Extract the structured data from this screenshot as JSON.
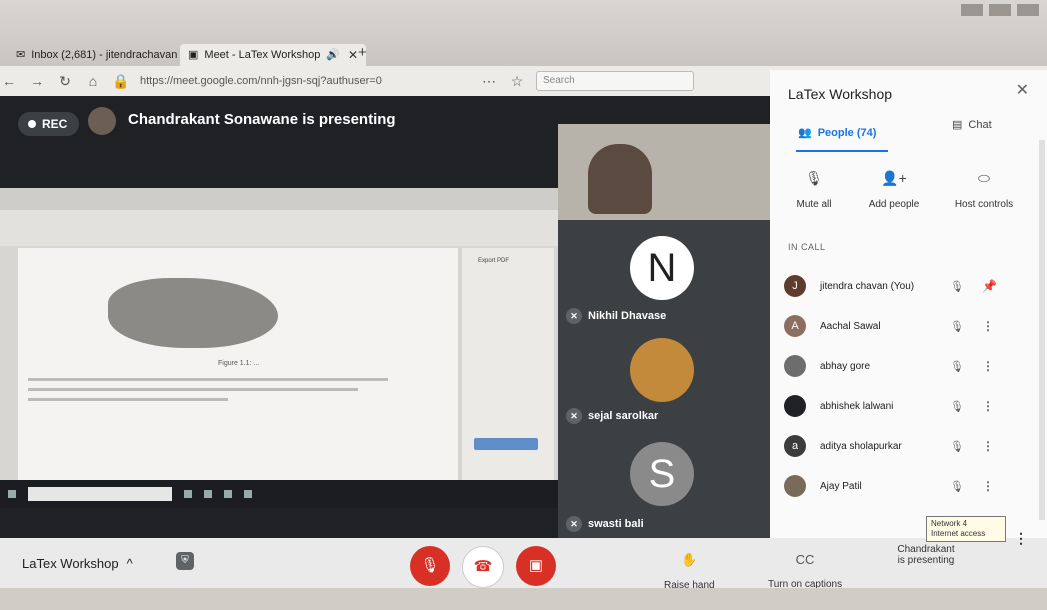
{
  "browser": {
    "tabs": [
      {
        "label": "Inbox (2,681) - jitendrachavan",
        "icon": "mail-icon"
      },
      {
        "label": "Meet - LaTex Workshop",
        "icon": "meet-icon"
      }
    ],
    "url": "https://meet.google.com/nnh-jgsn-sqj?authuser=0",
    "search_placeholder": "Search"
  },
  "meet": {
    "rec_label": "REC",
    "presenting_title": "Chandrakant Sonawane is presenting",
    "tiles": [
      {
        "name": "Nikhil Dhavase",
        "initial": "N"
      },
      {
        "name": "sejal sarolkar",
        "initial": ""
      },
      {
        "name": "swasti bali",
        "initial": "S"
      }
    ],
    "presentation": {
      "side_title": "Export PDF",
      "caption": "Figure 1.1: ..."
    }
  },
  "panel": {
    "title": "LaTex Workshop",
    "people_tab": "People (74)",
    "chat_tab": "Chat",
    "mute_all": "Mute all",
    "add_people": "Add people",
    "host_controls": "Host controls",
    "in_call_label": "IN CALL",
    "participants": [
      {
        "name": "jitendra chavan (You)",
        "initial": "J",
        "color": "#5f3b2e"
      },
      {
        "name": "Aachal Sawal",
        "initial": "A",
        "color": "#8d6e63"
      },
      {
        "name": "abhay gore",
        "initial": "",
        "color": "#6d6d6d"
      },
      {
        "name": "abhishek lalwani",
        "initial": "",
        "color": "#202124"
      },
      {
        "name": "aditya sholapurkar",
        "initial": "a",
        "color": "#3c3c3c"
      },
      {
        "name": "Ajay Patil",
        "initial": "",
        "color": "#7a6a5a"
      }
    ]
  },
  "controls": {
    "meeting_name": "LaTex Workshop",
    "raise_hand": "Raise hand",
    "captions": "Turn on captions",
    "presenting_line1": "Chandrakant",
    "presenting_line2": "is presenting",
    "network_tooltip_1": "Network 4",
    "network_tooltip_2": "Internet access"
  }
}
